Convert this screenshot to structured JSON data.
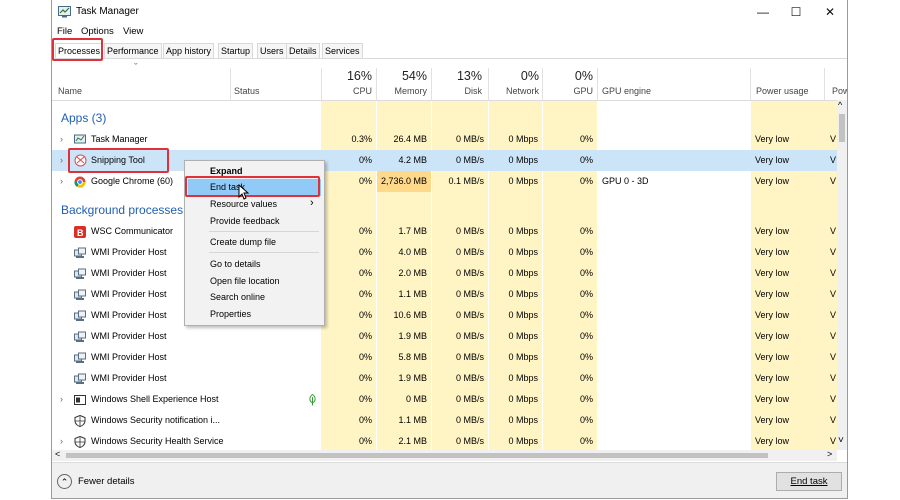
{
  "window": {
    "title": "Task Manager",
    "minimize": "—",
    "maximize": "☐",
    "close": "✕"
  },
  "menu": [
    "File",
    "Options",
    "View"
  ],
  "tabs": [
    "Processes",
    "Performance",
    "App history",
    "Startup",
    "Users",
    "Details",
    "Services"
  ],
  "header": {
    "cpu_pct": "16%",
    "memory_pct": "54%",
    "disk_pct": "13%",
    "network_pct": "0%",
    "gpu_pct": "0%",
    "name": "Name",
    "status": "Status",
    "cpu": "CPU",
    "memory": "Memory",
    "disk": "Disk",
    "network": "Network",
    "gpu": "GPU",
    "gpu_engine": "GPU engine",
    "power": "Power usage",
    "power_trend": "Pow"
  },
  "groups": {
    "apps": "Apps (3)",
    "background": "Background processes ("
  },
  "rows": [
    {
      "name": "Task Manager",
      "cpu": "0.3%",
      "mem": "26.4 MB",
      "disk": "0 MB/s",
      "net": "0 Mbps",
      "gpu": "0%",
      "engine": "",
      "power": "Very low",
      "trend": "V"
    },
    {
      "name": "Snipping Tool",
      "cpu": "0%",
      "mem": "4.2 MB",
      "disk": "0 MB/s",
      "net": "0 Mbps",
      "gpu": "0%",
      "engine": "",
      "power": "Very low",
      "trend": "V"
    },
    {
      "name": "Google Chrome (60)",
      "cpu": "0%",
      "mem": "2,736.0 MB",
      "disk": "0.1 MB/s",
      "net": "0 Mbps",
      "gpu": "0%",
      "engine": "GPU 0 - 3D",
      "power": "Very low",
      "trend": "V"
    },
    {
      "name": "WSC Communicator",
      "cpu": "0%",
      "mem": "1.7 MB",
      "disk": "0 MB/s",
      "net": "0 Mbps",
      "gpu": "0%",
      "engine": "",
      "power": "Very low",
      "trend": "V"
    },
    {
      "name": "WMI Provider Host",
      "cpu": "0%",
      "mem": "4.0 MB",
      "disk": "0 MB/s",
      "net": "0 Mbps",
      "gpu": "0%",
      "engine": "",
      "power": "Very low",
      "trend": "V"
    },
    {
      "name": "WMI Provider Host",
      "cpu": "0%",
      "mem": "2.0 MB",
      "disk": "0 MB/s",
      "net": "0 Mbps",
      "gpu": "0%",
      "engine": "",
      "power": "Very low",
      "trend": "V"
    },
    {
      "name": "WMI Provider Host",
      "cpu": "0%",
      "mem": "1.1 MB",
      "disk": "0 MB/s",
      "net": "0 Mbps",
      "gpu": "0%",
      "engine": "",
      "power": "Very low",
      "trend": "V"
    },
    {
      "name": "WMI Provider Host",
      "cpu": "0%",
      "mem": "10.6 MB",
      "disk": "0 MB/s",
      "net": "0 Mbps",
      "gpu": "0%",
      "engine": "",
      "power": "Very low",
      "trend": "V"
    },
    {
      "name": "WMI Provider Host",
      "cpu": "0%",
      "mem": "1.9 MB",
      "disk": "0 MB/s",
      "net": "0 Mbps",
      "gpu": "0%",
      "engine": "",
      "power": "Very low",
      "trend": "V"
    },
    {
      "name": "WMI Provider Host",
      "cpu": "0%",
      "mem": "5.8 MB",
      "disk": "0 MB/s",
      "net": "0 Mbps",
      "gpu": "0%",
      "engine": "",
      "power": "Very low",
      "trend": "V"
    },
    {
      "name": "WMI Provider Host",
      "cpu": "0%",
      "mem": "1.9 MB",
      "disk": "0 MB/s",
      "net": "0 Mbps",
      "gpu": "0%",
      "engine": "",
      "power": "Very low",
      "trend": "V"
    },
    {
      "name": "Windows Shell Experience Host",
      "cpu": "0%",
      "mem": "0 MB",
      "disk": "0 MB/s",
      "net": "0 Mbps",
      "gpu": "0%",
      "engine": "",
      "power": "Very low",
      "trend": "V"
    },
    {
      "name": "Windows Security notification i...",
      "cpu": "0%",
      "mem": "1.1 MB",
      "disk": "0 MB/s",
      "net": "0 Mbps",
      "gpu": "0%",
      "engine": "",
      "power": "Very low",
      "trend": "V"
    },
    {
      "name": "Windows Security Health Service",
      "cpu": "0%",
      "mem": "2.1 MB",
      "disk": "0 MB/s",
      "net": "0 Mbps",
      "gpu": "0%",
      "engine": "",
      "power": "Very low",
      "trend": "V"
    }
  ],
  "context_menu": [
    "Expand",
    "End task",
    "Resource values",
    "Provide feedback",
    "Create dump file",
    "Go to details",
    "Open file location",
    "Search online",
    "Properties"
  ],
  "context_submenu_arrow": "›",
  "footer": {
    "fewer_details": "Fewer details",
    "end_task": "End task"
  },
  "glyphs": {
    "sort": "ˇ",
    "expand": "›",
    "scroll_up": "^",
    "scroll_down": "˅",
    "scroll_left": "<",
    "scroll_right": ">",
    "fewer": "⌃"
  },
  "colors": {
    "highlight_red": "#e0313a",
    "selection": "#cce4f7",
    "menu_hover": "#91c9f7",
    "group_blue": "#1e5fb4",
    "heat_light": "#fff4c4",
    "heat_strong": "#ffd98a"
  }
}
